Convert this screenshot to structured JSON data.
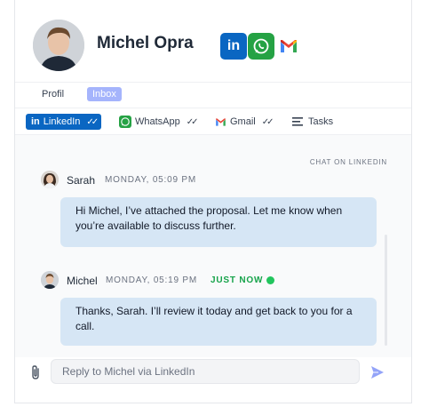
{
  "contact": {
    "name": "Michel Opra"
  },
  "header": {
    "channels": [
      {
        "icon": "linkedin-icon",
        "color": "#0a66c2"
      },
      {
        "icon": "whatsapp-icon",
        "color": "#25a244"
      },
      {
        "icon": "gmail-icon",
        "color": "#ea4335"
      }
    ]
  },
  "tabs": {
    "profil": "Profil",
    "inbox": "Inbox"
  },
  "channel_tabs": {
    "linkedin": "LinkedIn",
    "whatsapp": "WhatsApp",
    "gmail": "Gmail",
    "tasks": "Tasks"
  },
  "chat": {
    "label": "CHAT ON LINKEDIN",
    "messages": [
      {
        "sender": "Sarah",
        "time": "MONDAY, 05:09 PM",
        "text": "Hi Michel, I’ve attached the proposal. Let me know when you’re available to discuss further."
      },
      {
        "sender": "Michel",
        "time": "MONDAY, 05:19 PM",
        "status": "JUST NOW",
        "text": "Thanks, Sarah. I’ll review it today and get back to you for a call."
      }
    ]
  },
  "composer": {
    "placeholder": "Reply to Michel via LinkedIn"
  },
  "colors": {
    "accent": "#0a66c2",
    "inbox_badge": "#a5b4fc",
    "bubble": "#d6e6f5",
    "online": "#22c55e"
  }
}
